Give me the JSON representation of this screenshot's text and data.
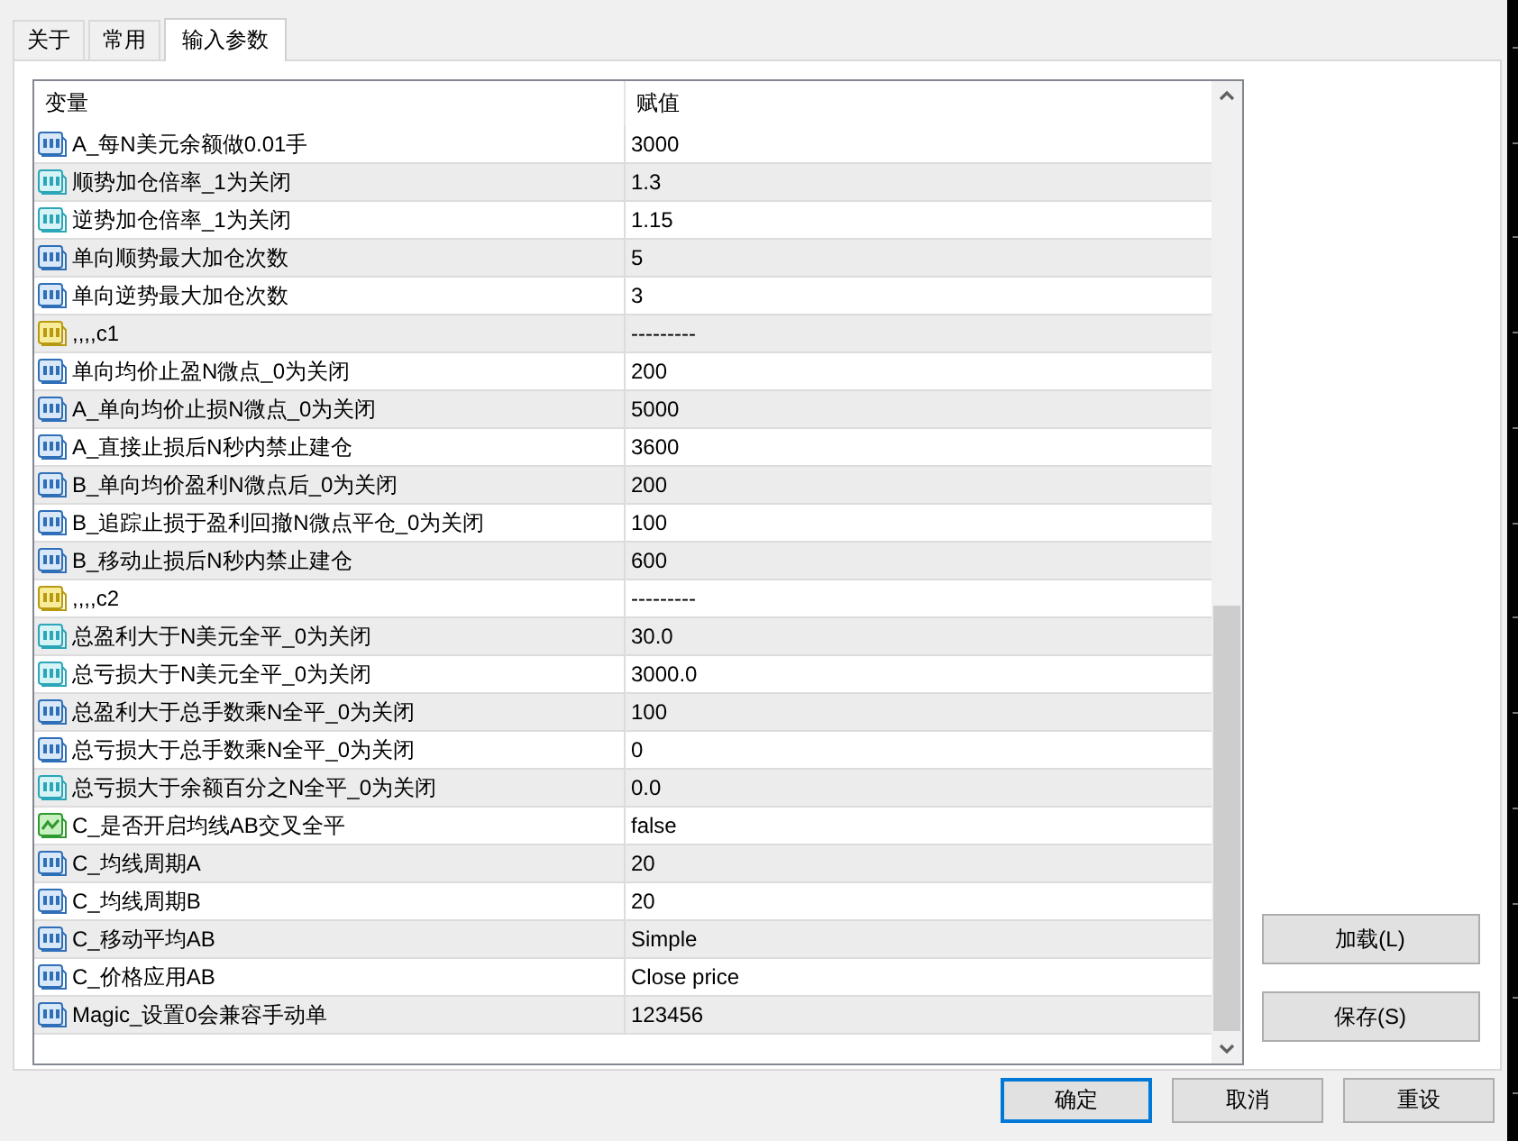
{
  "tabs": [
    {
      "label": "关于",
      "selected": false
    },
    {
      "label": "常用",
      "selected": false
    },
    {
      "label": "输入参数",
      "selected": true
    }
  ],
  "table": {
    "columns": [
      "变量",
      "赋值"
    ],
    "rows": [
      {
        "kind": "int",
        "name": "A_每N美元余额做0.01手",
        "value": "3000"
      },
      {
        "kind": "double",
        "name": "顺势加仓倍率_1为关闭",
        "value": "1.3"
      },
      {
        "kind": "double",
        "name": "逆势加仓倍率_1为关闭",
        "value": "1.15"
      },
      {
        "kind": "int",
        "name": "单向顺势最大加仓次数",
        "value": "5"
      },
      {
        "kind": "int",
        "name": "单向逆势最大加仓次数",
        "value": "3"
      },
      {
        "kind": "string",
        "name": ",,,,c1",
        "value": "---------"
      },
      {
        "kind": "int",
        "name": "单向均价止盈N微点_0为关闭",
        "value": "200"
      },
      {
        "kind": "int",
        "name": "A_单向均价止损N微点_0为关闭",
        "value": "5000"
      },
      {
        "kind": "int",
        "name": "A_直接止损后N秒内禁止建仓",
        "value": "3600"
      },
      {
        "kind": "int",
        "name": "B_单向均价盈利N微点后_0为关闭",
        "value": "200"
      },
      {
        "kind": "int",
        "name": "B_追踪止损于盈利回撤N微点平仓_0为关闭",
        "value": "100"
      },
      {
        "kind": "int",
        "name": "B_移动止损后N秒内禁止建仓",
        "value": "600"
      },
      {
        "kind": "string",
        "name": ",,,,c2",
        "value": "---------"
      },
      {
        "kind": "double",
        "name": "总盈利大于N美元全平_0为关闭",
        "value": "30.0"
      },
      {
        "kind": "double",
        "name": "总亏损大于N美元全平_0为关闭",
        "value": "3000.0"
      },
      {
        "kind": "int",
        "name": "总盈利大于总手数乘N全平_0为关闭",
        "value": "100"
      },
      {
        "kind": "int",
        "name": "总亏损大于总手数乘N全平_0为关闭",
        "value": "0"
      },
      {
        "kind": "double",
        "name": "总亏损大于余额百分之N全平_0为关闭",
        "value": "0.0"
      },
      {
        "kind": "bool",
        "name": "C_是否开启均线AB交叉全平",
        "value": "false"
      },
      {
        "kind": "int",
        "name": "C_均线周期A",
        "value": "20"
      },
      {
        "kind": "int",
        "name": "C_均线周期B",
        "value": "20"
      },
      {
        "kind": "int",
        "name": "C_移动平均AB",
        "value": "Simple"
      },
      {
        "kind": "int",
        "name": "C_价格应用AB",
        "value": "Close price"
      },
      {
        "kind": "int",
        "name": "Magic_设置0会兼容手动单",
        "value": "123456"
      }
    ]
  },
  "side_buttons": [
    "加载(L)",
    "保存(S)"
  ],
  "buttons": [
    {
      "label": "确定",
      "focused": true
    },
    {
      "label": "取消",
      "focused": false
    },
    {
      "label": "重设",
      "focused": false
    }
  ]
}
